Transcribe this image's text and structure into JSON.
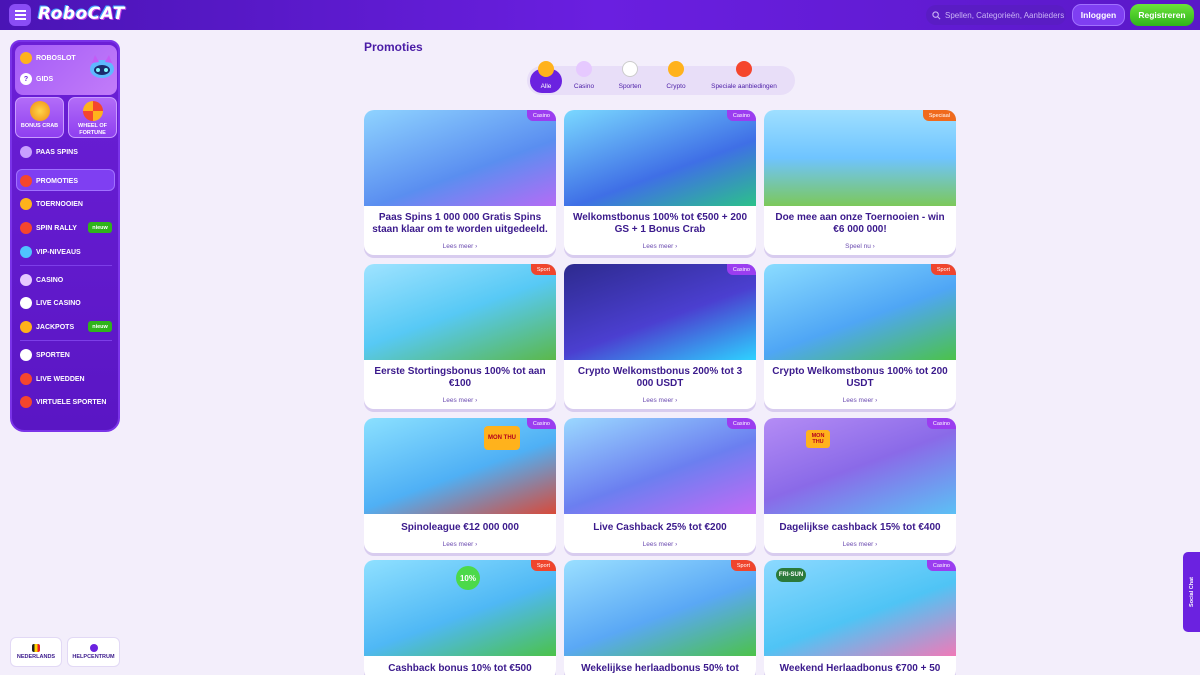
{
  "header": {
    "logo": "RoboCAT",
    "search_placeholder": "Spellen, Categorieën, Aanbieders",
    "login_label": "Inloggen",
    "register_label": "Registreren"
  },
  "sidebar": {
    "roboslot": "ROBOSLOT",
    "gids": "GIDS",
    "tiles": [
      "BONUS CRAB",
      "WHEEL OF FORTUNE"
    ],
    "items": [
      "PAAS SPINS",
      "PROMOTIES",
      "TOERNOOIEN",
      "SPIN RALLY",
      "VIP-NIVEAUS",
      "CASINO",
      "LIVE CASINO",
      "JACKPOTS",
      "SPORTEN",
      "LIVE WEDDEN",
      "VIRTUELE SPORTEN"
    ],
    "new_badge": "nieuw"
  },
  "footer": {
    "language": "NEDERLANDS",
    "help": "HELPCENTRUM"
  },
  "page": {
    "title": "Promoties",
    "filters": [
      "Alle",
      "Casino",
      "Sporten",
      "Crypto",
      "Speciale aanbiedingen"
    ]
  },
  "cards": [
    {
      "title": "Paas Spins 1 000 000 Gratis Spins staan klaar om te worden uitgedeeld.",
      "tag": "Casino",
      "link": "Lees meer"
    },
    {
      "title": "Welkomstbonus 100% tot €500 + 200 GS + 1 Bonus Crab",
      "tag": "Casino",
      "link": "Lees meer"
    },
    {
      "title": "Doe mee aan onze Toernooien - win €6 000 000!",
      "tag": "Speciaal",
      "link": "Speel nu"
    },
    {
      "title": "Eerste Stortingsbonus 100% tot aan €100",
      "tag": "Sport",
      "link": "Lees meer"
    },
    {
      "title": "Crypto Welkomstbonus 200% tot 3 000 USDT",
      "tag": "Casino",
      "link": "Lees meer"
    },
    {
      "title": "Crypto Welkomstbonus 100% tot 200 USDT",
      "tag": "Sport",
      "link": "Lees meer"
    },
    {
      "title": "Spinoleague €12 000 000",
      "tag": "Casino",
      "link": "Lees meer"
    },
    {
      "title": "Live Cashback 25% tot €200",
      "tag": "Casino",
      "link": "Lees meer"
    },
    {
      "title": "Dagelijkse cashback 15% tot €400",
      "tag": "Casino",
      "link": "Lees meer"
    },
    {
      "title": "Cashback bonus 10% tot €500",
      "tag": "Sport",
      "link": ""
    },
    {
      "title": "Wekelijkse herlaadbonus 50% tot",
      "tag": "Sport",
      "link": ""
    },
    {
      "title": "Weekend Herlaadbonus €700 + 50",
      "tag": "Casino",
      "link": ""
    }
  ],
  "card_art": {
    "labels": [
      "MON THU",
      "10%",
      "FRI-SUN"
    ]
  },
  "social_chat": "Social Chat",
  "colors": {
    "brand_purple": "#6b22e0",
    "register_green": "#2fb31b",
    "tag_casino": "#9b3df0",
    "tag_sport": "#f0452d",
    "tag_special": "#f06a1d"
  }
}
